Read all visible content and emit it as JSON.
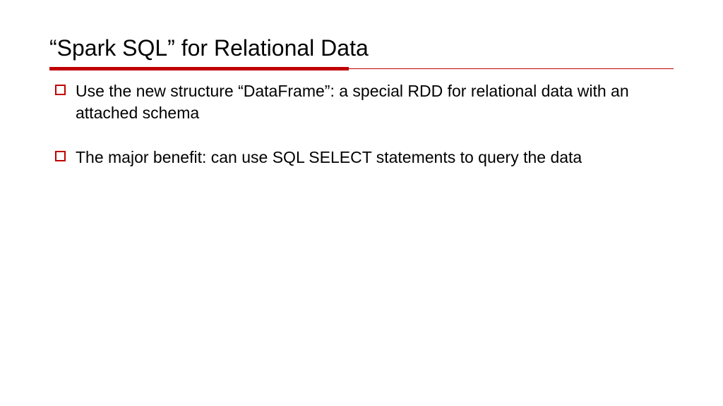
{
  "slide": {
    "title": "“Spark SQL” for Relational Data",
    "bullets": [
      "Use the new structure “DataFrame”: a special RDD for relational data with an attached schema",
      "The major benefit: can use SQL SELECT statements to query the data"
    ]
  }
}
